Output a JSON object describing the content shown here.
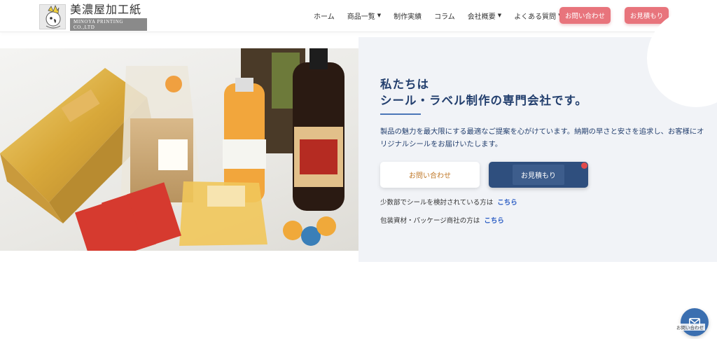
{
  "header": {
    "logo_name": "美濃屋加工紙",
    "logo_sub": "MINOYA PRINTING CO.,LTD",
    "nav": [
      {
        "label": "ホーム",
        "has_caret": false
      },
      {
        "label": "商品一覧",
        "has_caret": true
      },
      {
        "label": "制作実績",
        "has_caret": false
      },
      {
        "label": "コラム",
        "has_caret": false
      },
      {
        "label": "会社概要",
        "has_caret": true
      },
      {
        "label": "よくある質問",
        "has_caret": true
      }
    ],
    "caret": "▼",
    "contact_button": "お問い合わせ",
    "estimate_button": "お見積もり"
  },
  "hero": {
    "headline_line1": "私たちは",
    "headline_line2": "シール・ラベル制作の専門会社です。",
    "description": "製品の魅力を最大限にする最適なご提案を心がけています。納期の早さと安さを追求し、お客様にオリジナルシールをお届けいたします。",
    "contact_button": "お問い合わせ",
    "estimate_button": "お見積もり",
    "link1_text": "少数部でシールを検討されている方は",
    "link1_label": "こちら",
    "link2_text": "包装資材・パッケージ商社の方は",
    "link2_label": "こちら"
  },
  "chat": {
    "label": "お問い合わせ",
    "icon": "envelope-icon"
  },
  "colors": {
    "accent_pink": "#e8747c",
    "navy": "#233f6e",
    "link_blue": "#2a5cc4",
    "panel_bg": "#f1f3f7"
  }
}
